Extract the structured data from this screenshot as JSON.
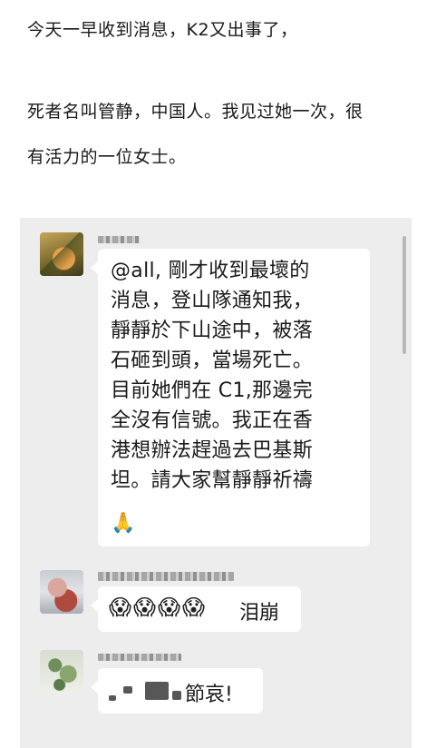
{
  "article": {
    "line1": "今天一早收到消息，K2又出事了，",
    "line2": "死者名叫管静，中国人。我见过她一次，很",
    "line3": "有活力的一位女士。"
  },
  "chat": {
    "messages": [
      {
        "text": "@all, 剛才收到最壞的\n消息，登山隊通知我，\n靜靜於下山途中，被落\n石砸到頭，當場死亡。\n目前她們在 C1,那邊完\n全沒有信號。我正在香\n港想辦法趕過去巴基斯\n坦。請大家幫靜靜祈禱",
        "emoji": "🙏"
      },
      {
        "emojis": "😱😱😱😱",
        "text": "泪崩"
      },
      {
        "text": "節哀!"
      }
    ]
  },
  "colors": {
    "chat_background": "#ededed",
    "bubble": "#ffffff"
  }
}
